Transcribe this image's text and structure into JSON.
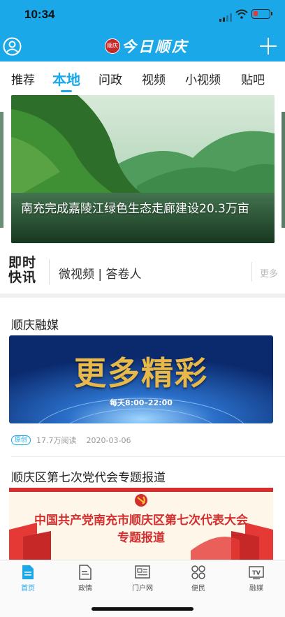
{
  "status_bar": {
    "time": "10:34"
  },
  "header": {
    "brand_title": "今日顺庆",
    "seal_text": "顺庆",
    "user_icon": "user-circle-icon",
    "add_icon": "plus-icon",
    "background_color": "#1aa8e8"
  },
  "tabs": [
    {
      "label": "推荐",
      "active": false
    },
    {
      "label": "本地",
      "active": true
    },
    {
      "label": "问政",
      "active": false
    },
    {
      "label": "视频",
      "active": false
    },
    {
      "label": "小视频",
      "active": false
    },
    {
      "label": "贴吧",
      "active": false
    }
  ],
  "banner": {
    "caption": "南充完成嘉陵江绿色生态走廊建设20.3万亩"
  },
  "flash_news": {
    "logo_line1": "即时",
    "logo_line2": "快讯",
    "text": "微视频 | 答卷人",
    "more": "更多"
  },
  "articles": [
    {
      "title": "顺庆融媒",
      "image_text": "更多精彩",
      "image_subtext": "每天8:00–22:00",
      "badge": "原创",
      "reads": "17.7万阅读",
      "date": "2020-03-06"
    },
    {
      "title": "顺庆区第七次党代会专题报道",
      "poster_line1": "中国共产党南充市顺庆区第七次代表大会",
      "poster_line2": "专题报道"
    }
  ],
  "bottom_nav": [
    {
      "label": "首页",
      "icon": "home-doc-icon",
      "active": true
    },
    {
      "label": "政情",
      "icon": "policy-doc-icon",
      "active": false
    },
    {
      "label": "门户网",
      "icon": "portal-icon",
      "active": false
    },
    {
      "label": "便民",
      "icon": "services-grid-icon",
      "active": false
    },
    {
      "label": "融媒",
      "icon": "tv-icon",
      "active": false
    }
  ],
  "colors": {
    "accent": "#1aa8e8",
    "party_red": "#d32f2f"
  }
}
